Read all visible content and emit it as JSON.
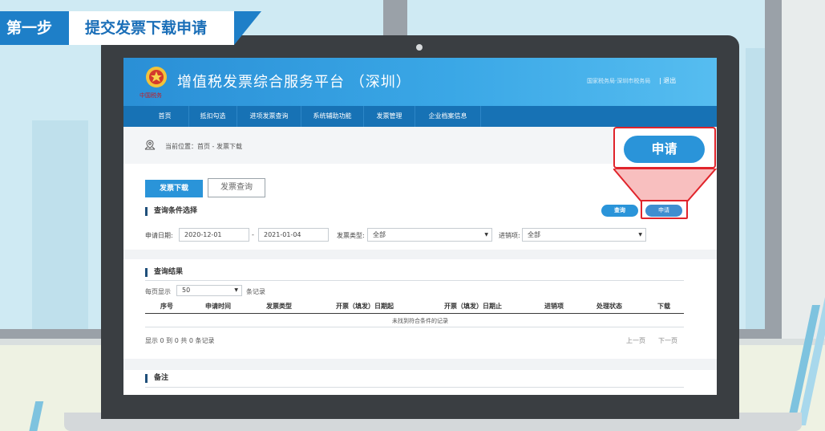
{
  "banner": {
    "step": "第一步",
    "title": "提交发票下载申请"
  },
  "header": {
    "site_title": "增值税发票综合服务平台 （深圳）",
    "emblem_text": "中国税务",
    "user_info": "国家税务局·深圳市税务局",
    "logout": "| 退出"
  },
  "nav": {
    "items": [
      "首页",
      "抵扣勾选",
      "进项发票查询",
      "系统辅助功能",
      "发票管理",
      "企业档案信息"
    ]
  },
  "breadcrumb": {
    "label": "当前位置：首页 - 发票下载"
  },
  "tabs": {
    "active": "发票下载",
    "idle": "发票查询"
  },
  "query": {
    "section_title": "查询条件选择",
    "query_button": "查询",
    "apply_button": "申请",
    "date_label": "申请日期:",
    "date_from": "2020-12-01",
    "date_sep": "-",
    "date_to": "2021-01-04",
    "type_label": "发票类型:",
    "type_value": "全部",
    "io_label": "进销项:",
    "io_value": "全部"
  },
  "results": {
    "section_title": "查询结果",
    "page_size_prefix": "每页显示",
    "page_size": "50",
    "page_size_suffix": "条记录",
    "columns": [
      "序号",
      "申请时间",
      "发票类型",
      "开票（填发）日期起",
      "开票（填发）日期止",
      "进销项",
      "处理状态",
      "下载"
    ],
    "empty_message": "未找到符合条件的记录",
    "summary": "显示 0 到 0 共 0 条记录",
    "prev": "上一页",
    "next": "下一页"
  },
  "remarks": {
    "section_title": "备注"
  },
  "callout": {
    "apply_big": "申请"
  },
  "colors": {
    "primary_blue": "#2a94d9",
    "nav_blue": "#1772b5",
    "highlight_red": "#e0242b"
  }
}
